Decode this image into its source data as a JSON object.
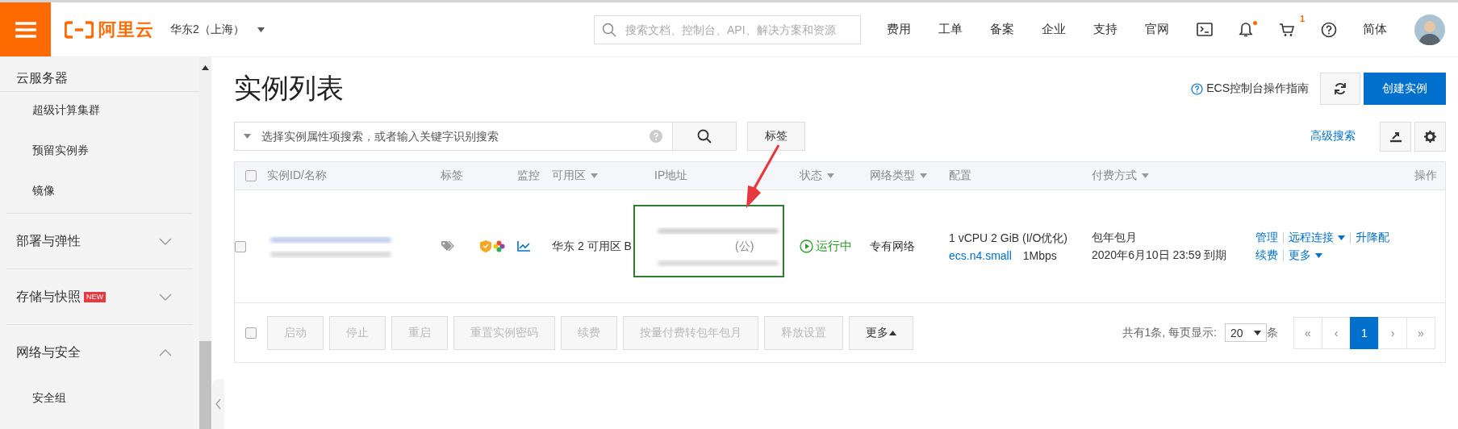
{
  "topbar": {
    "logo": "阿里云",
    "region": "华东2（上海）",
    "search": {
      "placeholder": "搜索文档、控制台、API、解决方案和资源"
    },
    "nav": [
      "费用",
      "工单",
      "备案",
      "企业",
      "支持",
      "官网"
    ],
    "icons": [
      {
        "kind": "terminal"
      },
      {
        "kind": "bell",
        "dot": true
      },
      {
        "kind": "cart",
        "badge": "1"
      },
      {
        "kind": "help"
      }
    ],
    "language": "简体"
  },
  "sidebar": {
    "title": "云服务器",
    "items": [
      {
        "kind": "sub",
        "label": "超级计算集群"
      },
      {
        "kind": "sub",
        "label": "预留实例券"
      },
      {
        "kind": "sub",
        "label": "镜像"
      },
      {
        "kind": "group",
        "label": "部署与弹性",
        "expanded": false
      },
      {
        "kind": "group",
        "label": "存储与快照",
        "badge": "NEW",
        "expanded": false
      },
      {
        "kind": "group",
        "label": "网络与安全",
        "expanded": true,
        "children": [
          {
            "label": "安全组"
          }
        ]
      }
    ]
  },
  "page": {
    "title": "实例列表",
    "guide_link": "ECS控制台操作指南",
    "create_button": "创建实例",
    "search": {
      "placeholder": "选择实例属性项搜索，或者输入关键字识别搜索"
    },
    "tag_button": "标签",
    "advanced_search": "高级搜索"
  },
  "table": {
    "select_all": {
      "checked": false
    },
    "columns": [
      {
        "label": "实例ID/名称",
        "sortable": false
      },
      {
        "label": "标签",
        "sortable": false
      },
      {
        "label": "监控",
        "sortable": false
      },
      {
        "label": "可用区",
        "sortable": true
      },
      {
        "label": "IP地址",
        "sortable": false
      },
      {
        "label": "状态",
        "sortable": true
      },
      {
        "label": "网络类型",
        "sortable": true
      },
      {
        "label": "配置",
        "sortable": false
      },
      {
        "label": "付费方式",
        "sortable": true
      },
      {
        "label": "操作",
        "sortable": false
      }
    ],
    "rows": [
      {
        "checked": false,
        "redacted": true,
        "zone": "华东 2 可用区 B",
        "ip_note": "(公)",
        "status": "运行中",
        "network": "专有网络",
        "config": "1 vCPU 2 GiB (I/O优化)",
        "instance_type": "ecs.n4.small",
        "bandwidth": "1Mbps",
        "billing": "包年包月",
        "expiry": "2020年6月10日 23:59 到期",
        "actions": [
          [
            {
              "label": "管理",
              "dropdown": false
            },
            {
              "label": "远程连接",
              "dropdown": true
            },
            {
              "label": "升降配",
              "dropdown": false
            }
          ],
          [
            {
              "label": "续费",
              "dropdown": false
            },
            {
              "label": "更多",
              "dropdown": true
            }
          ]
        ]
      }
    ]
  },
  "footer": {
    "select_all": {
      "checked": false
    },
    "buttons": [
      {
        "label": "启动",
        "disabled": true,
        "dropdown": false
      },
      {
        "label": "停止",
        "disabled": true,
        "dropdown": false
      },
      {
        "label": "重启",
        "disabled": true,
        "dropdown": false
      },
      {
        "label": "重置实例密码",
        "disabled": true,
        "dropdown": false
      },
      {
        "label": "续费",
        "disabled": true,
        "dropdown": false
      },
      {
        "label": "按量付费转包年包月",
        "disabled": true,
        "dropdown": false
      },
      {
        "label": "释放设置",
        "disabled": true,
        "dropdown": false
      },
      {
        "label": "更多",
        "disabled": false,
        "dropdown": true
      }
    ],
    "summary": "共有1条, 每页显示:",
    "page_size": "20",
    "unit": "条",
    "pages": [
      {
        "label": "«",
        "selected": false
      },
      {
        "label": "‹",
        "selected": false
      },
      {
        "label": "1",
        "selected": true
      },
      {
        "label": "›",
        "selected": false
      },
      {
        "label": "»",
        "selected": false
      }
    ]
  },
  "annotations": [
    {
      "kind": "box",
      "color": "#2e7d32"
    },
    {
      "kind": "arrow",
      "color": "#e8383d"
    }
  ]
}
